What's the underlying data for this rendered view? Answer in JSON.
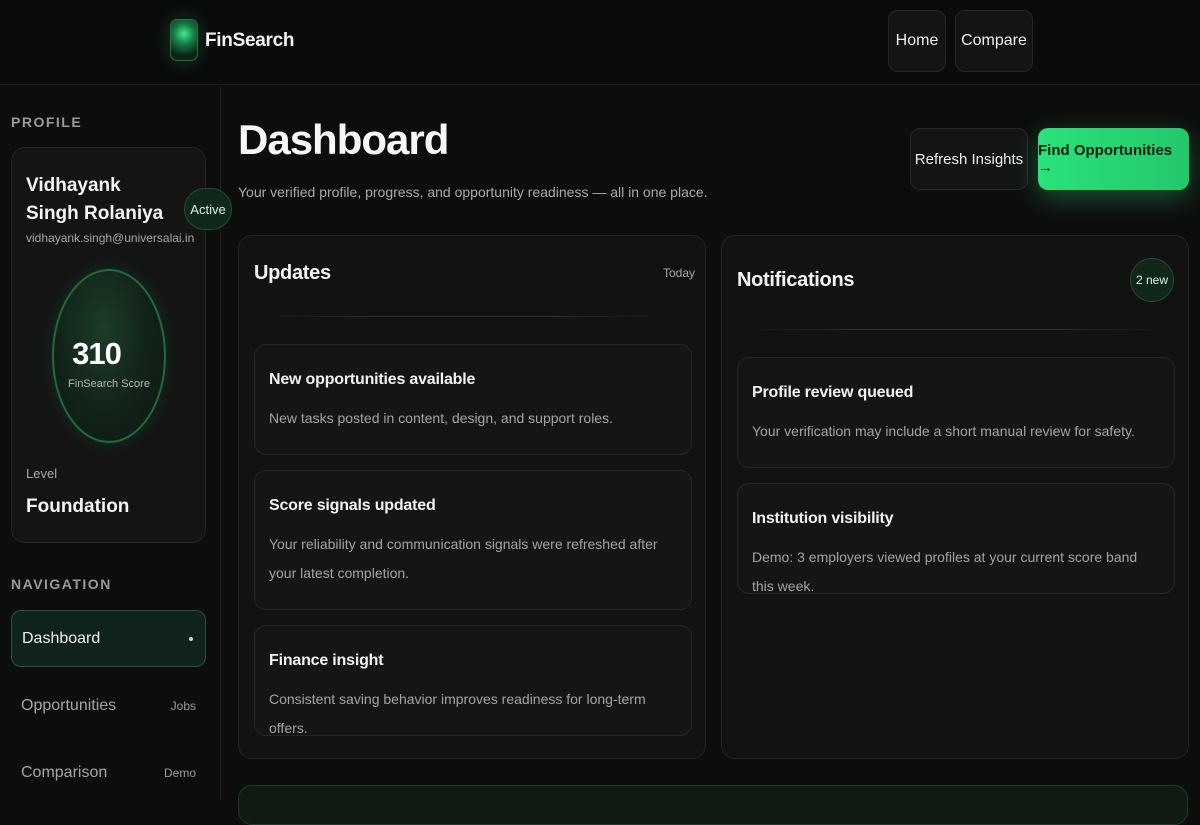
{
  "app": {
    "brand": "FinSearch"
  },
  "topnav": {
    "home_label": "Home",
    "compare_label": "Compare"
  },
  "sidebar": {
    "profile_heading": "PROFILE",
    "profile": {
      "name": "Vidhayank Singh Rolaniya",
      "email": "vidhayank.singh@universalai.in",
      "status": "Active",
      "score": "310",
      "score_label": "FinSearch Score",
      "level_label": "Level",
      "level_value": "Foundation"
    },
    "nav_heading": "NAVIGATION",
    "nav_items": [
      {
        "label": "Dashboard",
        "meta": ""
      },
      {
        "label": "Opportunities",
        "meta": "Jobs"
      },
      {
        "label": "Comparison",
        "meta": "Demo"
      }
    ]
  },
  "main": {
    "title": "Dashboard",
    "subtitle": "Your verified profile, progress, and opportunity readiness — all in one place.",
    "refresh_label": "Refresh Insights",
    "find_label": "Find Opportunities →",
    "updates": {
      "title": "Updates",
      "meta": "Today",
      "items": [
        {
          "title": "New opportunities available",
          "body": "New tasks posted in content, design, and support roles."
        },
        {
          "title": "Score signals updated",
          "body": "Your reliability and communication signals were refreshed after your latest completion."
        },
        {
          "title": "Finance insight",
          "body": "Consistent saving behavior improves readiness for long-term offers."
        }
      ]
    },
    "notifications": {
      "title": "Notifications",
      "badge": "2 new",
      "items": [
        {
          "title": "Profile review queued",
          "body": "Your verification may include a short manual review for safety."
        },
        {
          "title": "Institution visibility",
          "body": "Demo: 3 employers viewed profiles at your current score band this week."
        }
      ]
    }
  },
  "colors": {
    "accent": "#2ae27a",
    "background": "#0d0d0d",
    "panel": "#121212"
  }
}
